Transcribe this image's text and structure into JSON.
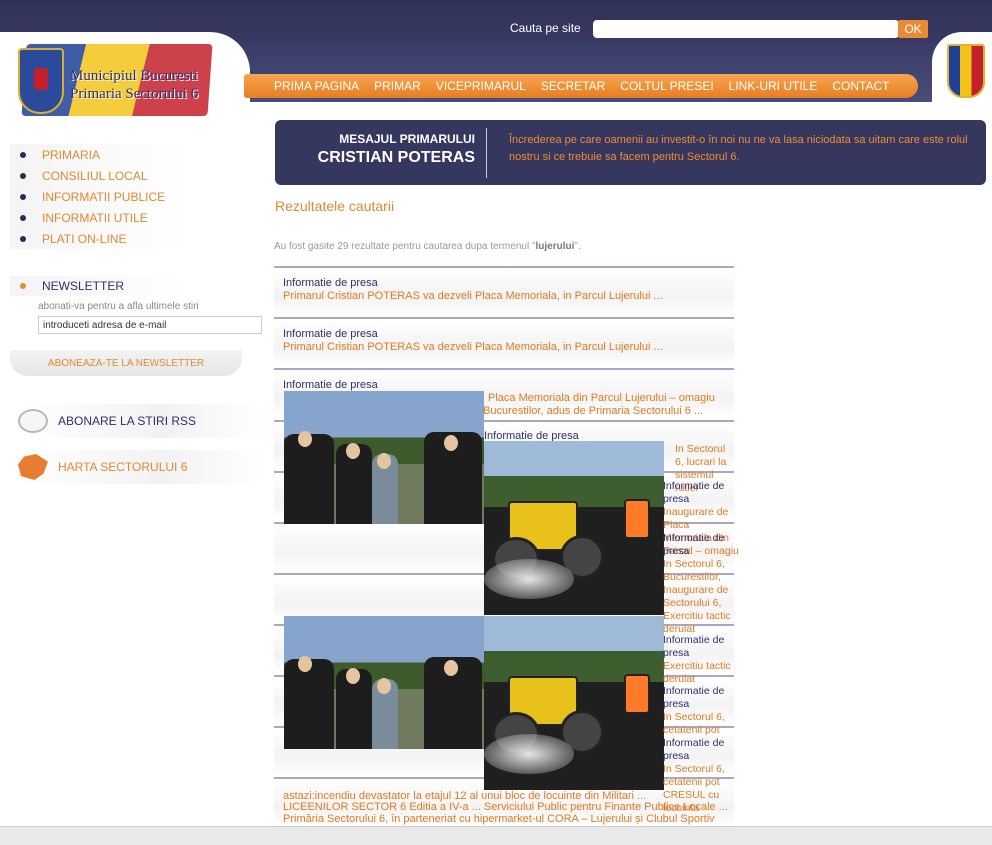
{
  "header": {
    "logo_line1": "Municipiul Bucuresti",
    "logo_line2": "Primaria Sectorului 6",
    "search_label": "Cauta pe site",
    "search_value": "",
    "search_button": "OK",
    "nav": [
      "PRIMA PAGINA",
      "PRIMAR",
      "VICEPRIMARUL",
      "SECRETAR",
      "COLTUL PRESEI",
      "LINK-URI UTILE",
      "CONTACT"
    ]
  },
  "sidebar": {
    "menu": [
      "PRIMARIA",
      "CONSILIUL LOCAL",
      "INFORMATII PUBLICE",
      "INFORMATII UTILE",
      "PLATI ON-LINE"
    ],
    "newsletter_title": "NEWSLETTER",
    "newsletter_hint": "abonati-va pentru a afla ultimele stiri",
    "newsletter_input": "introduceti adresa de e-mail",
    "newsletter_button": "ABONEAZA-TE LA NEWSLETTER",
    "rss": "ABONARE LA STIRI RSS",
    "map": "HARTA SECTORULUI 6"
  },
  "message": {
    "heading1": "MESAJUL PRIMARULUI",
    "heading2": "CRISTIAN POTERAS",
    "text": "Încrederea pe care oamenii au investit-o în noi nu ne va lasa niciodata sa uitam care este rolul nostru si ce trebuie sa facem pentru Sectorul 6."
  },
  "results": {
    "title": "Rezultatele cautarii",
    "count_prefix": "Au fost gasite 29 rezultate pentru cautarea dupa termenul \"",
    "count_term": "lujerului",
    "count_suffix": "\".",
    "items": [
      {
        "category": "Informatie de presa",
        "link": "Primarul Cristian POTERAS va dezveli Placa Memoriala, in Parcul Lujerului ..."
      },
      {
        "category": "Informatie de presa",
        "link": "Primarul Cristian POTERAS va dezveli Placa Memoriala, in Parcul Lujerului ..."
      },
      {
        "category": "Informatie de presa",
        "link_line1": "Placa Memoriala din Parcul Lujerului – omagiu",
        "link_line2": "Bucurestilor, adus de Primaria Sectorului 6 ..."
      },
      {
        "category": "Informatie de presa"
      }
    ],
    "overlap_right": {
      "link1": "In Sectorul 6, lucrari la sistemul rutier",
      "block_a": "Informatie de presa",
      "block_a_link": "Inaugurare de Placa Memoriala din Parcul – omagiu",
      "block_b": "Informatie de presa",
      "block_b_link": "In Sectorul 6, Bucurestilor, Inaugurare de Sectorului 6, Exercitiu tactic derulat",
      "block_c": "Informatie de presa",
      "block_c_link": "Exercitiu tactic derulat",
      "block_d": "Informatie de presa",
      "block_d_link": "In Sectorul 6, cetatenii pot",
      "block_e": "Informatie de presa",
      "block_e_link": "In Sectorul 6, cetatenii pot CRESUL cu locuinta"
    },
    "bottom_lines": [
      "astazi:incendiu devastator la etajul 12 al unui bloc de locuinte din Militari ...",
      "LICEENILOR SECTOR 6 Editia a IV-a ... Serviciului Public pentru Finante Publice Locale ...",
      "Primăria Sectorului 6, în parteneriat cu hipermarket-ul CORA – Lujerului și Clubul Sportiv"
    ]
  },
  "colors": {
    "header_dark": "#35375f",
    "accent_orange": "#e98a34",
    "link_orange": "#e07a22",
    "text_navy": "#2e2f6e"
  }
}
